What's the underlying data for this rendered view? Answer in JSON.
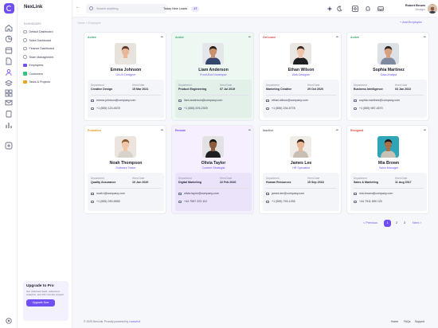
{
  "app": {
    "name": "NexLink",
    "dashboard_section": "DASHBOARD"
  },
  "sidebar": {
    "items": [
      {
        "label": "Default Dashboard",
        "marker": "circle"
      },
      {
        "label": "Sales Dashboard",
        "marker": "circle"
      },
      {
        "label": "Finance Dashboard",
        "marker": "circle"
      },
      {
        "label": "Team Management",
        "marker": "circle"
      },
      {
        "label": "Employees",
        "marker": "square",
        "color": "#6f4ef2"
      },
      {
        "label": "Customers",
        "marker": "square",
        "color": "#34c27d"
      },
      {
        "label": "Tasks & Projects",
        "marker": "square",
        "color": "#f2a31c"
      }
    ],
    "upgrade": {
      "title": "Upgrade to Pro",
      "desc": "Get unlimited leads, advanced analytics, and 24/7 priority support.",
      "button": "Upgrade Now"
    }
  },
  "header": {
    "search_placeholder": "Search anything",
    "leads_label": "Today New Leads",
    "leads_count": "27",
    "user_name": "Robert Brown",
    "user_role": "Manager"
  },
  "breadcrumb": "Home > Employee",
  "add_employee": "+ Add Employee",
  "labels": {
    "department": "Department",
    "hired": "Hired Date"
  },
  "employees": [
    {
      "status": "Active",
      "status_color": "#34a36b",
      "name": "Emma Johnson",
      "role": "UI/UX Designer",
      "department": "Creative Design",
      "hired": "15 Mar 2021",
      "email": "emma.johnson@company.com",
      "phone": "+1 (555) 123-4578",
      "bg": "#ffffff"
    },
    {
      "status": "Active",
      "status_color": "#34a36b",
      "name": "Liam Anderson",
      "role": "Front-End Developer",
      "department": "Product Engineering",
      "hired": "07 Jul 2019",
      "email": "liam.anderson@company.com",
      "phone": "+1 (555) 876-2309",
      "bg": "#eef8f3"
    },
    {
      "status": "On Leave",
      "status_color": "#e0453a",
      "name": "Ethan Wilson",
      "role": "Web Designer",
      "department": "Marketing Creative",
      "hired": "29 Oct 2020",
      "email": "ethan.wilson@company.com",
      "phone": "+1 (555) 234-5778",
      "bg": "#ffffff"
    },
    {
      "status": "Active",
      "status_color": "#34a36b",
      "name": "Sophia Martinez",
      "role": "Data Analyst",
      "department": "Business Intelligence",
      "hired": "03 Jan 2022",
      "email": "sophia.martinez@company.com",
      "phone": "+1 (555) 987-4570",
      "bg": "#ffffff"
    },
    {
      "status": "Probation",
      "status_color": "#e8941b",
      "name": "Noah Thompson",
      "role": "Software Tester",
      "department": "Quality Assurance",
      "hired": "10 Jun 2020",
      "email": "noah.t@company.com",
      "phone": "+1 (555) 290-5555",
      "bg": "#ffffff"
    },
    {
      "status": "Remote",
      "status_color": "#7a4ff0",
      "name": "Olivia Taylor",
      "role": "Content Strategist",
      "department": "Digital Marketing",
      "hired": "22 Feb 2020",
      "email": "olivia.taylor@company.com",
      "phone": "+44 7597 223 113",
      "bg": "#f5efff"
    },
    {
      "status": "Inactive",
      "status_color": "#6a6f85",
      "name": "James Lee",
      "role": "HR Specialist",
      "department": "Human Resources",
      "hired": "15 Sep 2018",
      "email": "james.lee@company.com",
      "phone": "+1 (555) 793-1255",
      "bg": "#ffffff"
    },
    {
      "status": "Resigned",
      "status_color": "#e0453a",
      "name": "Mia Brown",
      "role": "Sales Manager",
      "department": "Sales & Marketing",
      "hired": "11 Aug 2017",
      "email": "mia.brown@company.com",
      "phone": "+44 7911 890 120",
      "bg": "#ffffff"
    }
  ],
  "pagination": {
    "prev": "< Previous",
    "pages": [
      "1",
      "2",
      "3"
    ],
    "next": "Next >"
  },
  "footer": {
    "text": "© 2025 NexLink. Proudly powered by ",
    "brand": "LaunchUi",
    "links": [
      "Home",
      "FAQs",
      "Support"
    ]
  }
}
